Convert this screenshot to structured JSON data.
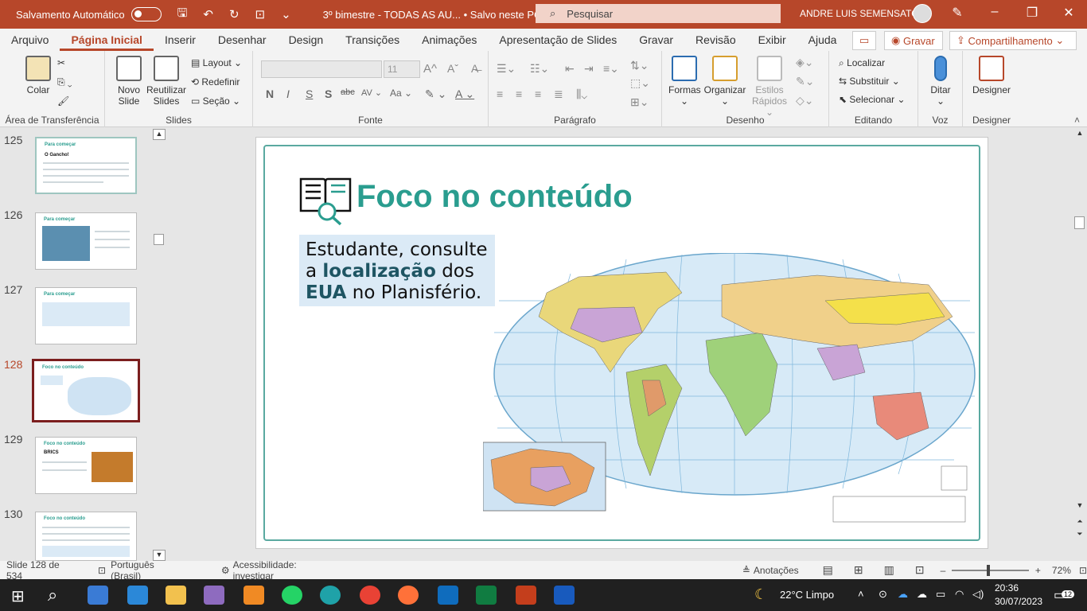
{
  "titlebar": {
    "autosave": "Salvamento Automático",
    "doc": "3º bimestre - TODAS AS AU...  •  Salvo neste PC",
    "search": "Pesquisar",
    "user": "ANDRE LUIS SEMENSATO"
  },
  "menu": [
    "Arquivo",
    "Página Inicial",
    "Inserir",
    "Desenhar",
    "Design",
    "Transições",
    "Animações",
    "Apresentação de Slides",
    "Gravar",
    "Revisão",
    "Exibir",
    "Ajuda"
  ],
  "rbuttons": {
    "gravar": "Gravar",
    "share": "Compartilhamento"
  },
  "ribbon": {
    "clipboard": {
      "label": "Área de Transferência",
      "paste": "Colar"
    },
    "slides": {
      "label": "Slides",
      "new": "Novo",
      "new2": "Slide",
      "reuse": "Reutilizar",
      "reuse2": "Slides",
      "layout": "Layout",
      "reset": "Redefinir",
      "section": "Seção"
    },
    "font": {
      "label": "Fonte",
      "size": "11"
    },
    "paragraph": {
      "label": "Parágrafo"
    },
    "drawing": {
      "label": "Desenho",
      "shapes": "Formas",
      "arrange": "Organizar",
      "styles": "Estilos",
      "styles2": "Rápidos"
    },
    "editing": {
      "label": "Editando",
      "find": "Localizar",
      "replace": "Substituir",
      "select": "Selecionar"
    },
    "voice": {
      "label": "Voz",
      "dictate": "Ditar"
    },
    "designer": {
      "label": "Designer",
      "btn": "Designer"
    }
  },
  "thumbs": [
    {
      "num": "125",
      "title": "Para começar",
      "sub": "O Gancho!"
    },
    {
      "num": "126",
      "title": "Para começar",
      "sub": ""
    },
    {
      "num": "127",
      "title": "Para começar",
      "sub": ""
    },
    {
      "num": "128",
      "title": "Foco no conteúdo",
      "sub": ""
    },
    {
      "num": "129",
      "title": "Foco no conteúdo",
      "sub": "BRICS"
    },
    {
      "num": "130",
      "title": "Foco no conteúdo",
      "sub": ""
    }
  ],
  "slide": {
    "title": "Foco no conteúdo",
    "note_pre": "Estudante, consulte a ",
    "note_b1": "localização",
    "note_mid": " dos ",
    "note_b2": "EUA",
    "note_post": " no Planisfério."
  },
  "status": {
    "slide": "Slide 128 de 534",
    "lang": "Português (Brasil)",
    "access": "Acessibilidade: investigar",
    "notes": "Anotações",
    "zoom": "72%"
  },
  "taskbar": {
    "weather": "22°C  Limpo",
    "time": "20:36",
    "date": "30/07/2023",
    "badge": "12"
  }
}
